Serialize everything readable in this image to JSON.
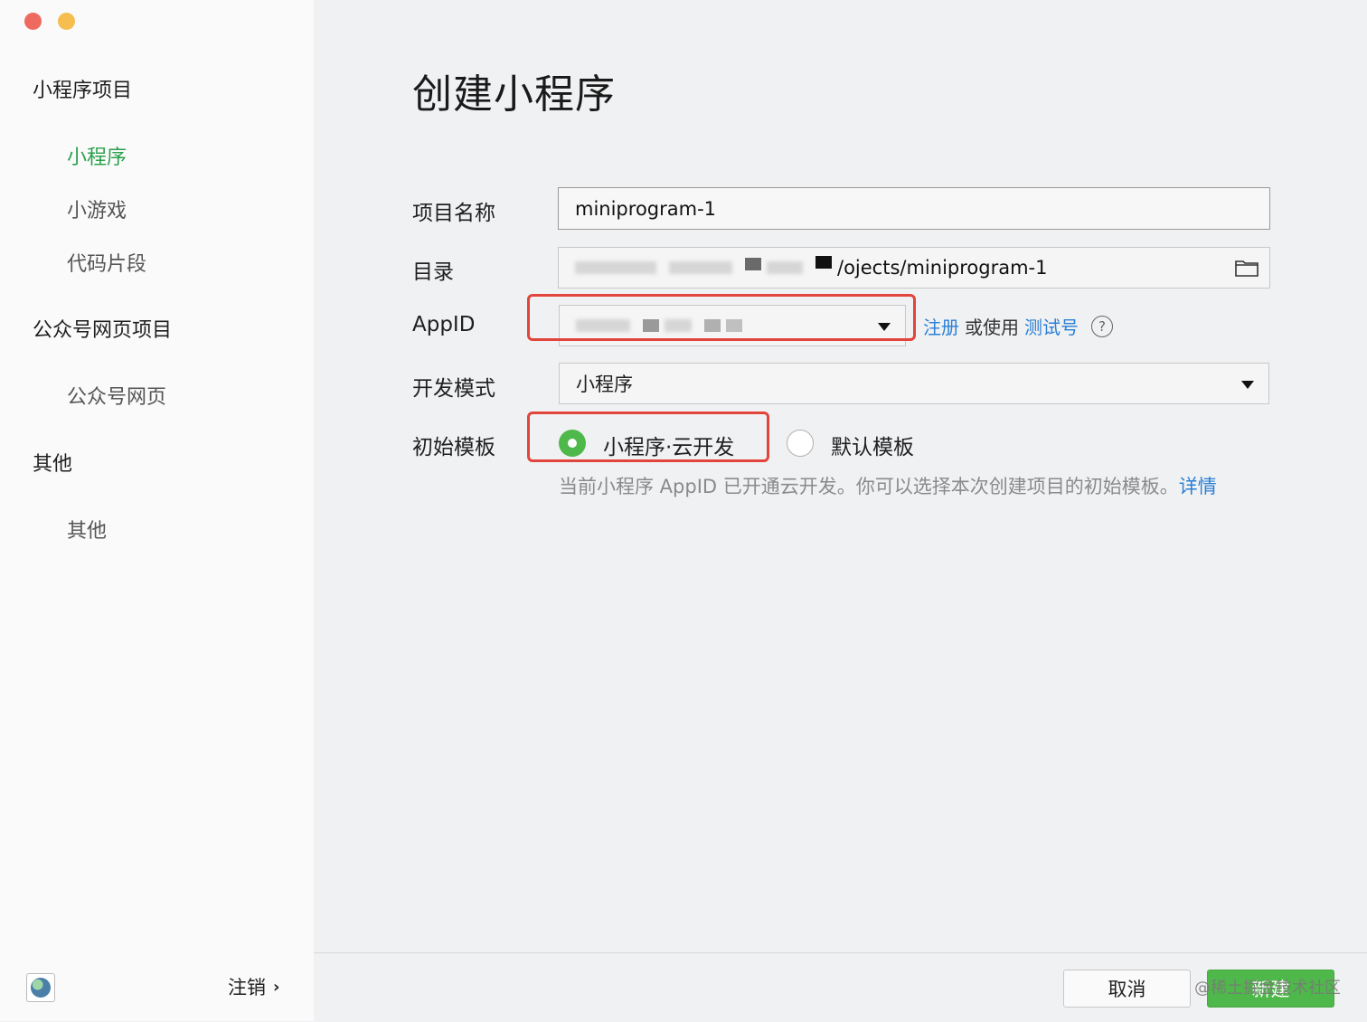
{
  "sidebar": {
    "groups": [
      {
        "title": "小程序项目",
        "items": [
          "小程序",
          "小游戏",
          "代码片段"
        ]
      },
      {
        "title": "公众号网页项目",
        "items": [
          "公众号网页"
        ]
      },
      {
        "title": "其他",
        "items": [
          "其他"
        ]
      }
    ],
    "active_item": "小程序",
    "logout_label": "注销",
    "logout_chevron": "›"
  },
  "main": {
    "title": "创建小程序",
    "fields": {
      "project_name": {
        "label": "项目名称",
        "value": "miniprogram-1"
      },
      "directory": {
        "label": "目录",
        "value_visible": "/ojects/miniprogram-1"
      },
      "appid": {
        "label": "AppID",
        "register_link": "注册",
        "or_use": "或使用",
        "test_link": "测试号",
        "help": "?"
      },
      "dev_mode": {
        "label": "开发模式",
        "value": "小程序"
      },
      "template": {
        "label": "初始模板",
        "options": [
          {
            "label": "小程序·云开发",
            "selected": true
          },
          {
            "label": "默认模板",
            "selected": false
          }
        ],
        "hint": "当前小程序 AppID 已开通云开发。你可以选择本次创建项目的初始模板。",
        "hint_link": "详情"
      }
    },
    "buttons": {
      "cancel": "取消",
      "create": "新建"
    },
    "watermark": "@稀土掘金技术社区"
  },
  "colors": {
    "accent_green": "#4fb84a",
    "active_nav_green": "#2ba14d",
    "link_blue": "#2a7fd6",
    "highlight_red": "#e2453c"
  },
  "icons": {
    "window_close": "close-dot",
    "window_minimize": "minimize-dot",
    "folder": "folder-icon",
    "dropdown": "caret-down-icon",
    "help": "question-circle-icon",
    "avatar": "globe-icon"
  }
}
